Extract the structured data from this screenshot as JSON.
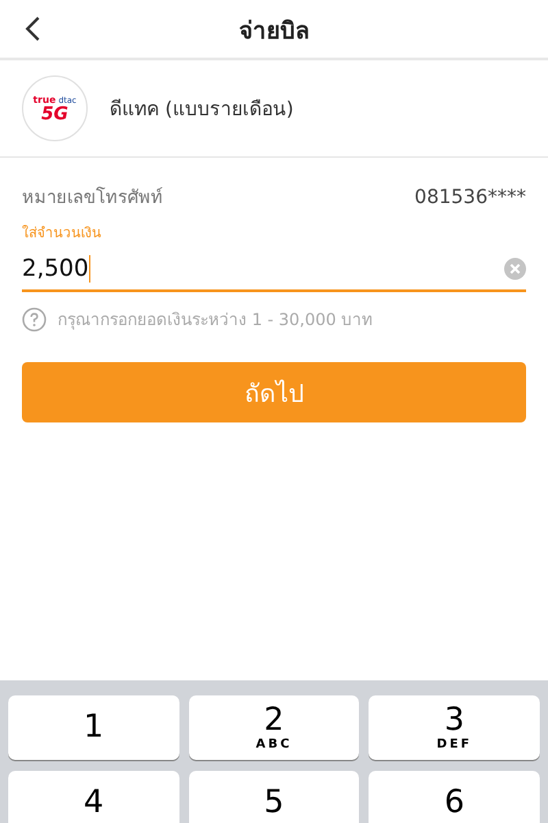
{
  "header": {
    "title": "จ่ายบิล"
  },
  "provider": {
    "logo": {
      "brand": "true",
      "sub": "dtac",
      "badge": "5G"
    },
    "name": "ดีแทค (แบบรายเดือน)"
  },
  "phone": {
    "label": "หมายเลขโทรศัพท์",
    "value": "081536****"
  },
  "amount": {
    "label": "ใส่จำนวนเงิน",
    "value": "2,500",
    "focused": true
  },
  "hint": "กรุณากรอกยอดเงินระหว่าง 1 - 30,000 บาท",
  "next_button": "ถัดไป",
  "keypad": [
    {
      "digit": "1"
    },
    {
      "digit": "2",
      "letters": "ABC"
    },
    {
      "digit": "3",
      "letters": "DEF"
    },
    {
      "digit": "4"
    },
    {
      "digit": "5"
    },
    {
      "digit": "6"
    }
  ]
}
